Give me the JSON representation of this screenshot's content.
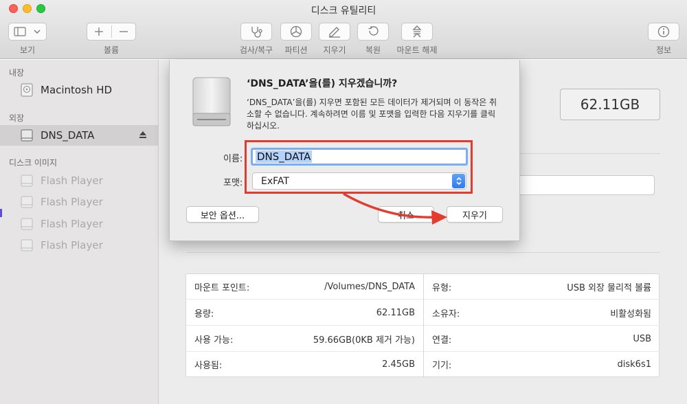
{
  "window": {
    "title": "디스크 유틸리티"
  },
  "toolbar": {
    "view_label": "보기",
    "volume_label": "볼륨",
    "firstaid_label": "검사/복구",
    "partition_label": "파티션",
    "erase_label": "지우기",
    "restore_label": "복원",
    "unmount_label": "마운트 해제",
    "info_label": "정보"
  },
  "sidebar": {
    "internal_header": "내장",
    "external_header": "외장",
    "images_header": "디스크 이미지",
    "internal_items": [
      {
        "label": "Macintosh HD"
      }
    ],
    "external_items": [
      {
        "label": "DNS_DATA"
      }
    ],
    "image_items": [
      {
        "label": "Flash Player"
      },
      {
        "label": "Flash Player"
      },
      {
        "label": "Flash Player"
      },
      {
        "label": "Flash Player"
      }
    ]
  },
  "main": {
    "capacity": "62.11GB",
    "info_left": [
      {
        "key": "마운트 포인트:",
        "value": "/Volumes/DNS_DATA"
      },
      {
        "key": "용량:",
        "value": "62.11GB"
      },
      {
        "key": "사용 가능:",
        "value": "59.66GB(0KB 제거 가능)"
      },
      {
        "key": "사용됨:",
        "value": "2.45GB"
      }
    ],
    "info_right": [
      {
        "key": "유형:",
        "value": "USB 외장 물리적 볼륨"
      },
      {
        "key": "소유자:",
        "value": "비활성화됨"
      },
      {
        "key": "연결:",
        "value": "USB"
      },
      {
        "key": "기기:",
        "value": "disk6s1"
      }
    ]
  },
  "dialog": {
    "title": "‘DNS_DATA’을(를) 지우겠습니까?",
    "message": "‘DNS_DATA’을(를) 지우면 포함된 모든 데이터가 제거되며 이 동작은 취소할 수 없습니다. 계속하려면 이름 및 포맷을 입력한 다음 지우기를 클릭하십시오.",
    "name_label": "이름:",
    "name_value": "DNS_DATA",
    "format_label": "포맷:",
    "format_value": "ExFAT",
    "security_button": "보안 옵션...",
    "cancel_button": "취소",
    "erase_button": "지우기"
  },
  "colors": {
    "highlight": "#e53a2e",
    "accent": "#2f7bf1",
    "selection": "#b3d3fd"
  }
}
